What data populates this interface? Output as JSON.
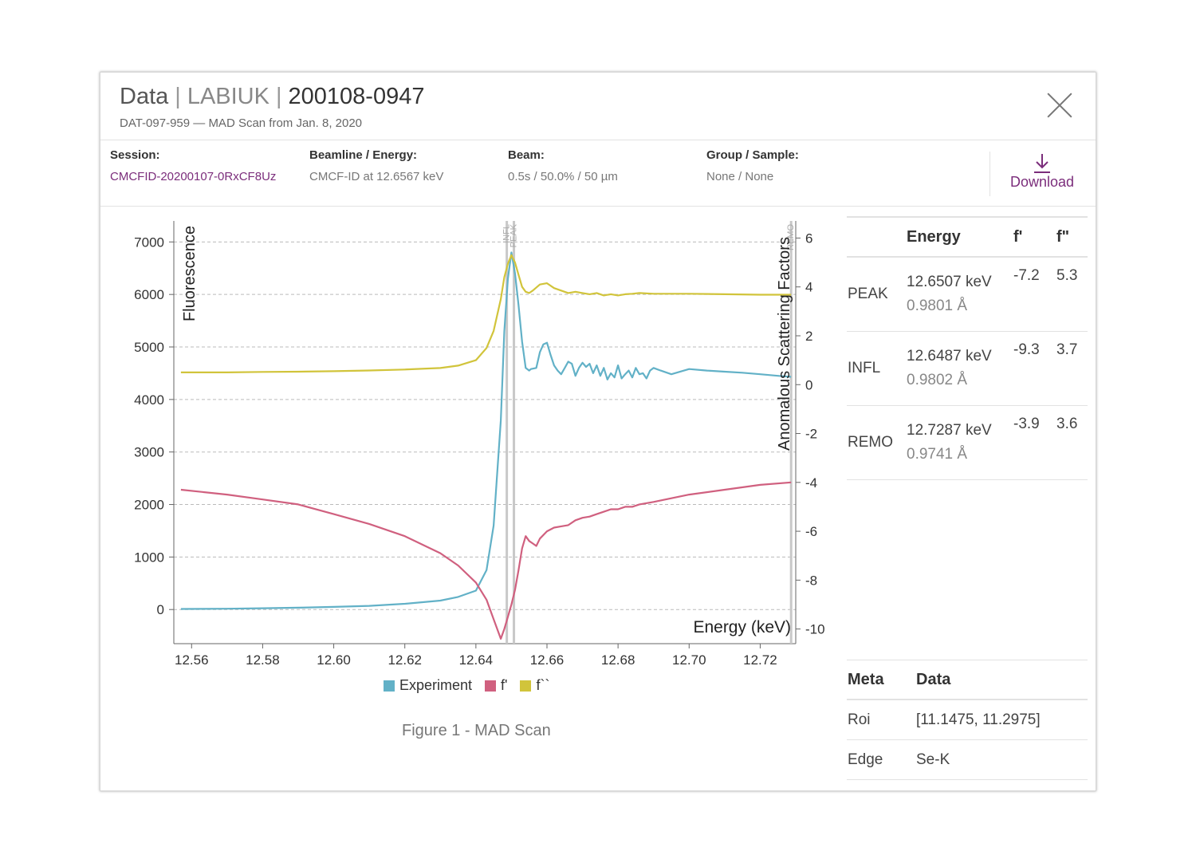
{
  "header": {
    "title_part1": "Data",
    "title_part2": "LABIUK",
    "title_part3": "200108-0947",
    "separator": "|",
    "subtitle": "DAT-097-959 — MAD Scan from Jan. 8, 2020",
    "close_icon": "close-icon"
  },
  "info": {
    "session_label": "Session:",
    "session_value": "CMCFID-20200107-0RxCF8Uz",
    "beamline_label": "Beamline / Energy:",
    "beamline_value": "CMCF-ID at 12.6567 keV",
    "beam_label": "Beam:",
    "beam_value": "0.5s / 50.0% / 50 µm",
    "group_label": "Group / Sample:",
    "group_value": "None / None",
    "download_label": "Download",
    "download_icon": "download-icon"
  },
  "colors": {
    "experiment": "#62b1c7",
    "f_prime": "#d0607f",
    "f_double_prime": "#d1c43b",
    "accent": "#7b2d7b"
  },
  "caption": "Figure 1 - MAD Scan",
  "energy_table": {
    "headers": [
      "",
      "Energy",
      "f'",
      "f\""
    ],
    "rows": [
      {
        "label": "PEAK",
        "energy": "12.6507 keV",
        "wavelength": "0.9801 Å",
        "fp": "-7.2",
        "fpp": "5.3"
      },
      {
        "label": "INFL",
        "energy": "12.6487 keV",
        "wavelength": "0.9802 Å",
        "fp": "-9.3",
        "fpp": "3.7"
      },
      {
        "label": "REMO",
        "energy": "12.7287 keV",
        "wavelength": "0.9741 Å",
        "fp": "-3.9",
        "fpp": "3.6"
      }
    ]
  },
  "meta_table": {
    "headers": [
      "Meta",
      "Data"
    ],
    "rows": [
      {
        "key": "Roi",
        "value": "[11.1475, 11.2975]"
      },
      {
        "key": "Edge",
        "value": "Se-K"
      }
    ]
  },
  "chart_data": {
    "type": "line",
    "xlabel": "Energy (keV)",
    "ylabel_left": "Fluorescence",
    "ylabel_right": "Anomalous Scattering Factors",
    "xlim": [
      12.555,
      12.73
    ],
    "ylim_left": [
      -650,
      7400
    ],
    "ylim_right": [
      -10.6,
      6.7
    ],
    "x_ticks": [
      "12.56",
      "12.58",
      "12.60",
      "12.62",
      "12.64",
      "12.66",
      "12.68",
      "12.70",
      "12.72"
    ],
    "y_left_ticks": [
      "0",
      "1000",
      "2000",
      "3000",
      "4000",
      "5000",
      "6000",
      "7000"
    ],
    "y_right_ticks": [
      "-10",
      "-8",
      "-6",
      "-4",
      "-2",
      "0",
      "2",
      "4",
      "6"
    ],
    "grid": true,
    "legend": "bottom",
    "markers": [
      {
        "label": "INFL",
        "x": 12.6487
      },
      {
        "label": "PEAK",
        "x": 12.6507
      },
      {
        "label": "REMO",
        "x": 12.7287
      }
    ],
    "series": [
      {
        "name": "Experiment",
        "axis": "left",
        "x": [
          12.557,
          12.57,
          12.58,
          12.59,
          12.6,
          12.61,
          12.62,
          12.63,
          12.635,
          12.64,
          12.643,
          12.645,
          12.647,
          12.648,
          12.649,
          12.65,
          12.651,
          12.652,
          12.653,
          12.654,
          12.655,
          12.6555,
          12.657,
          12.658,
          12.659,
          12.66,
          12.661,
          12.662,
          12.663,
          12.664,
          12.665,
          12.666,
          12.667,
          12.668,
          12.669,
          12.67,
          12.671,
          12.672,
          12.673,
          12.674,
          12.675,
          12.676,
          12.677,
          12.678,
          12.679,
          12.68,
          12.681,
          12.682,
          12.683,
          12.684,
          12.685,
          12.686,
          12.687,
          12.688,
          12.689,
          12.69,
          12.692,
          12.695,
          12.7,
          12.705,
          12.71,
          12.715,
          12.72,
          12.725,
          12.7287
        ],
        "values": [
          10,
          15,
          25,
          35,
          50,
          70,
          110,
          170,
          240,
          360,
          750,
          1600,
          3600,
          5300,
          6300,
          6800,
          6400,
          5800,
          5100,
          4600,
          4550,
          4580,
          4600,
          4900,
          5050,
          5080,
          4850,
          4650,
          4550,
          4480,
          4600,
          4720,
          4680,
          4450,
          4600,
          4700,
          4620,
          4680,
          4500,
          4650,
          4450,
          4600,
          4380,
          4500,
          4420,
          4650,
          4400,
          4480,
          4550,
          4420,
          4600,
          4480,
          4500,
          4400,
          4550,
          4600,
          4550,
          4480,
          4580,
          4550,
          4530,
          4510,
          4480,
          4450,
          4430
        ]
      },
      {
        "name": "f'",
        "axis": "right",
        "x": [
          12.557,
          12.57,
          12.58,
          12.59,
          12.6,
          12.61,
          12.62,
          12.63,
          12.635,
          12.64,
          12.643,
          12.645,
          12.647,
          12.648,
          12.649,
          12.65,
          12.651,
          12.652,
          12.653,
          12.654,
          12.655,
          12.656,
          12.657,
          12.658,
          12.66,
          12.662,
          12.664,
          12.666,
          12.668,
          12.67,
          12.672,
          12.674,
          12.676,
          12.678,
          12.68,
          12.682,
          12.684,
          12.686,
          12.69,
          12.7,
          12.71,
          12.72,
          12.7287
        ],
        "values": [
          -4.3,
          -4.5,
          -4.7,
          -4.9,
          -5.3,
          -5.7,
          -6.2,
          -6.9,
          -7.4,
          -8.1,
          -8.8,
          -9.6,
          -10.4,
          -10.0,
          -9.5,
          -9.0,
          -8.4,
          -7.6,
          -6.7,
          -6.2,
          -6.4,
          -6.5,
          -6.6,
          -6.3,
          -6.0,
          -5.85,
          -5.8,
          -5.75,
          -5.55,
          -5.45,
          -5.4,
          -5.3,
          -5.2,
          -5.1,
          -5.1,
          -5.0,
          -5.0,
          -4.9,
          -4.8,
          -4.5,
          -4.3,
          -4.1,
          -4.0
        ]
      },
      {
        "name": "f``",
        "axis": "right",
        "x": [
          12.557,
          12.57,
          12.58,
          12.59,
          12.6,
          12.61,
          12.62,
          12.63,
          12.635,
          12.64,
          12.643,
          12.645,
          12.647,
          12.648,
          12.649,
          12.65,
          12.651,
          12.652,
          12.653,
          12.654,
          12.655,
          12.656,
          12.658,
          12.66,
          12.662,
          12.664,
          12.666,
          12.668,
          12.67,
          12.672,
          12.674,
          12.676,
          12.678,
          12.68,
          12.682,
          12.684,
          12.686,
          12.69,
          12.7,
          12.71,
          12.72,
          12.7287
        ],
        "values": [
          0.5,
          0.5,
          0.52,
          0.53,
          0.55,
          0.58,
          0.62,
          0.68,
          0.78,
          1.0,
          1.5,
          2.2,
          3.5,
          4.4,
          4.95,
          5.3,
          5.0,
          4.5,
          4.0,
          3.8,
          3.75,
          3.85,
          4.1,
          4.15,
          3.95,
          3.85,
          3.75,
          3.8,
          3.75,
          3.7,
          3.75,
          3.65,
          3.7,
          3.65,
          3.7,
          3.72,
          3.75,
          3.72,
          3.72,
          3.7,
          3.68,
          3.68
        ]
      }
    ]
  }
}
